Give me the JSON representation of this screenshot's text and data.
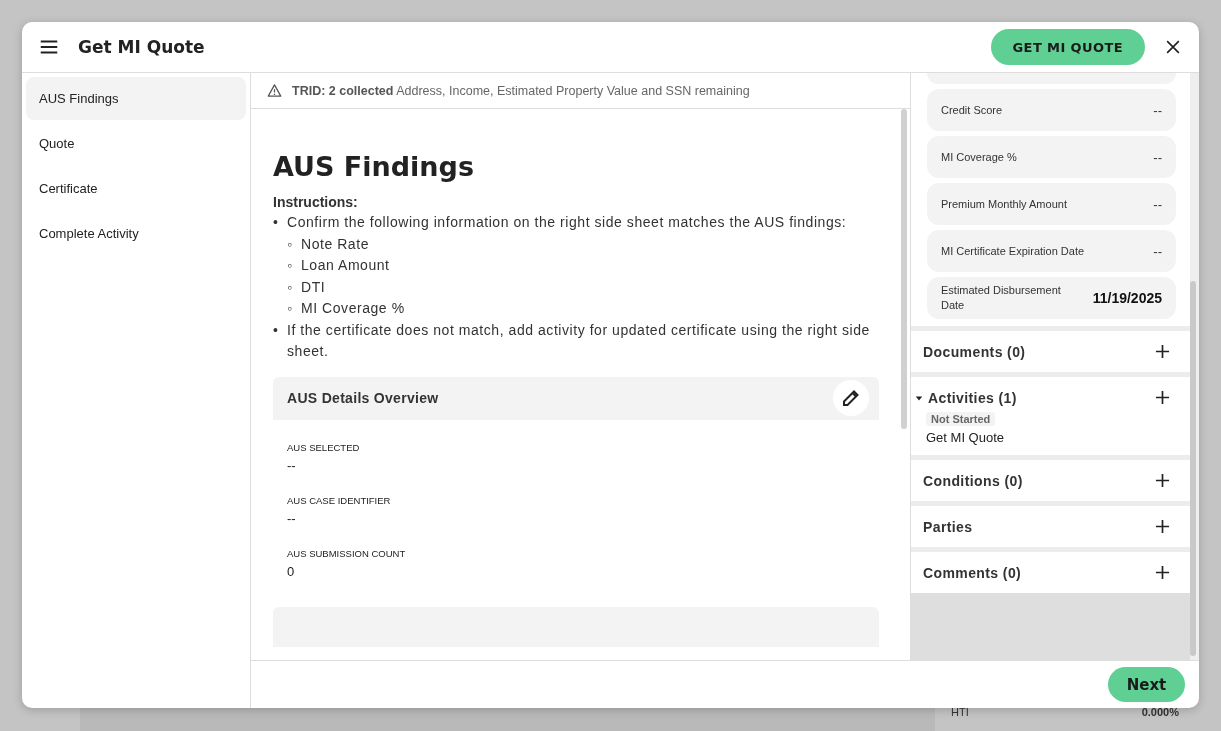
{
  "background": {
    "summary_row": {
      "label": "HTI",
      "value": "0.000%"
    }
  },
  "dialog": {
    "title": "Get MI Quote",
    "primary_button": "GET MI QUOTE",
    "next_button": "Next"
  },
  "nav": [
    {
      "label": "AUS Findings",
      "selected": true
    },
    {
      "label": "Quote",
      "selected": false
    },
    {
      "label": "Certificate",
      "selected": false
    },
    {
      "label": "Complete Activity",
      "selected": false
    }
  ],
  "notice": {
    "text": "**TRID: 2 collected** Address, Income, Estimated Property Value and SSN remaining"
  },
  "content": {
    "heading": "AUS Findings",
    "instructions_label": "Instructions:",
    "bullets": [
      {
        "marker": "•",
        "text": "Confirm the following information on the right side sheet matches the AUS findings:",
        "children": [
          {
            "marker": "◦",
            "text": "Note Rate"
          },
          {
            "marker": "◦",
            "text": "Loan Amount"
          },
          {
            "marker": "◦",
            "text": "DTI"
          },
          {
            "marker": "◦",
            "text": "MI Coverage %"
          }
        ]
      },
      {
        "marker": "•",
        "text": "If the certificate does not match, add activity for updated certificate using the right side sheet."
      }
    ],
    "card": {
      "title": "AUS Details Overview",
      "fields": [
        {
          "label": "AUS SELECTED",
          "value": "--"
        },
        {
          "label": "AUS CASE IDENTIFIER",
          "value": "--"
        },
        {
          "label": "AUS SUBMISSION COUNT",
          "value": "0"
        }
      ]
    }
  },
  "side_fields": [
    {
      "label": "Credit Score",
      "value": "--",
      "filled": false
    },
    {
      "label": "MI Coverage %",
      "value": "--",
      "filled": false
    },
    {
      "label": "Premium Monthly Amount",
      "value": "--",
      "filled": false
    },
    {
      "label": "MI Certificate Expiration Date",
      "value": "--",
      "filled": false
    },
    {
      "label": "Estimated Disbursement Date",
      "value": "11/19/2025",
      "filled": true
    }
  ],
  "sections": [
    {
      "title": "Documents (0)",
      "expanded": false
    },
    {
      "title": "Activities (1)",
      "expanded": true,
      "items": [
        {
          "status": "Not Started",
          "title": "Get MI Quote"
        }
      ]
    },
    {
      "title": "Conditions (0)",
      "expanded": false
    },
    {
      "title": "Parties",
      "expanded": false
    },
    {
      "title": "Comments (0)",
      "expanded": false
    }
  ]
}
